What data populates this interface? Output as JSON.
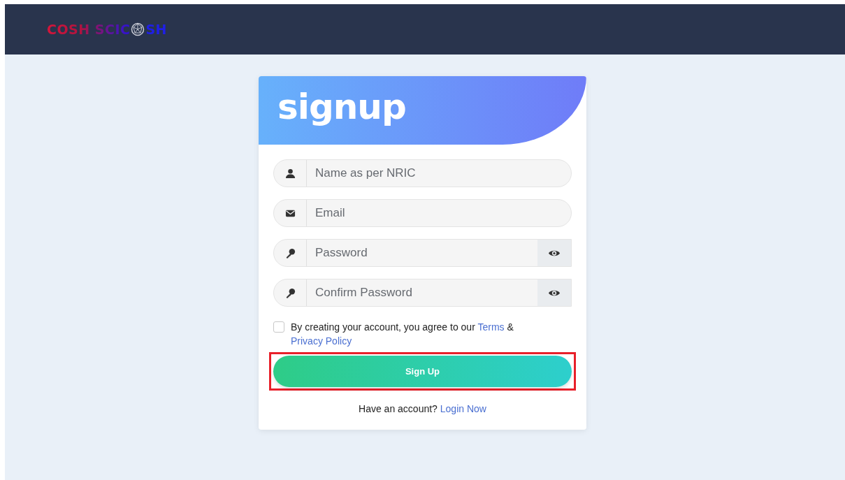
{
  "navbar": {
    "logo": {
      "before_icon": "COSH SCIC",
      "after_icon": "SH"
    }
  },
  "form": {
    "title": "signup",
    "fields": [
      {
        "kind": "name",
        "placeholder": "Name as per NRIC"
      },
      {
        "kind": "email",
        "placeholder": "Email"
      },
      {
        "kind": "password",
        "placeholder": "Password"
      },
      {
        "kind": "password",
        "placeholder": "Confirm Password"
      }
    ],
    "agreement": {
      "checked": false,
      "text": "By creating your account, you agree to our",
      "terms_link": "Terms",
      "joiner": "&",
      "privacy_link": "Privacy Policy"
    },
    "submit": {
      "label": "Sign Up",
      "highlighted": true
    },
    "footer": {
      "text": "Have an account?",
      "link": "Login Now"
    }
  }
}
